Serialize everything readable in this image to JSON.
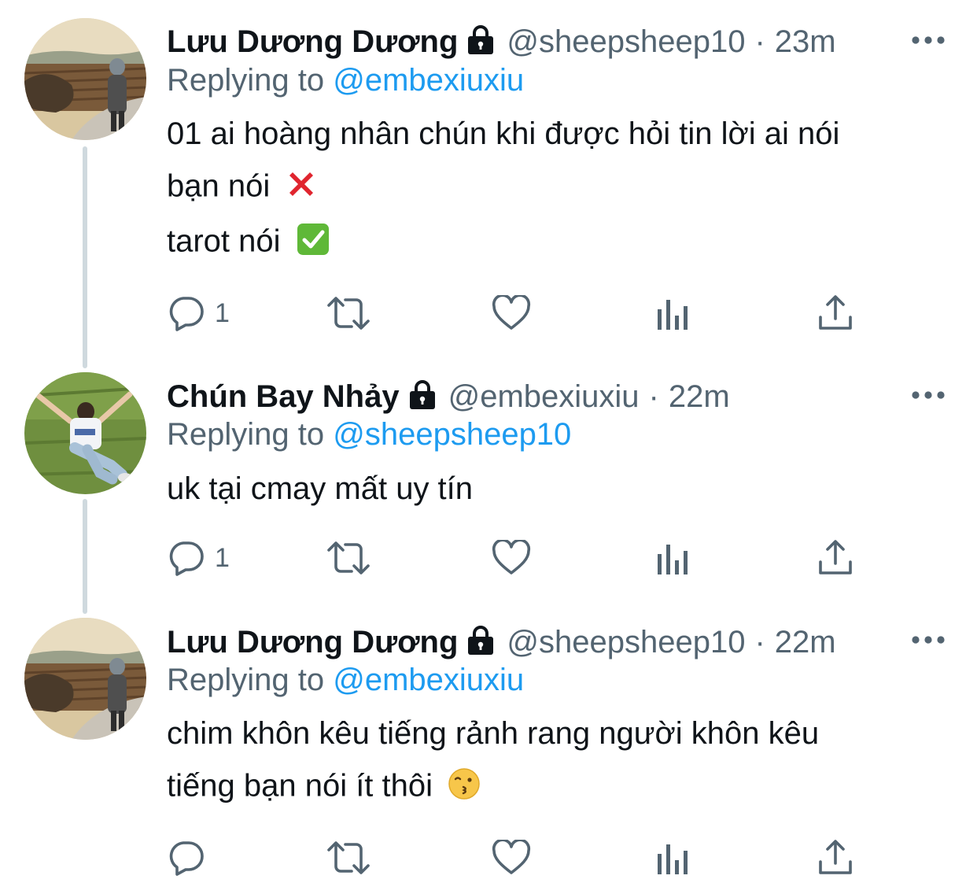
{
  "thread": {
    "tweets": [
      {
        "display_name": "Lưu Dương Dương",
        "handle": "@sheepsheep10",
        "dot": "·",
        "time": "23m",
        "replying_prefix": "Replying to ",
        "replying_to": "@embexiuxiu",
        "body_lines": [
          "01 ai hoàng nhân chún khi được hỏi tin lời ai nói",
          "bạn nói",
          "tarot nói"
        ],
        "reply_count": "1",
        "avatar_icon": "avatar-landscape-person"
      },
      {
        "display_name": "Chún Bay Nhảy",
        "handle": "@embexiuxiu",
        "dot": "·",
        "time": "22m",
        "replying_prefix": "Replying to ",
        "replying_to": "@sheepsheep10",
        "body_lines": [
          "uk tại cmay mất uy tín"
        ],
        "reply_count": "1",
        "avatar_icon": "avatar-grass-person"
      },
      {
        "display_name": "Lưu Dương Dương",
        "handle": "@sheepsheep10",
        "dot": "·",
        "time": "22m",
        "replying_prefix": "Replying to ",
        "replying_to": "@embexiuxiu",
        "body_lines": [
          "chim khôn kêu tiếng rảnh rang người khôn kêu",
          "tiếng bạn nói ít thôi"
        ],
        "reply_count": "",
        "avatar_icon": "avatar-landscape-person"
      }
    ]
  },
  "icons": {
    "lock": "lock-icon",
    "more": "more-icon",
    "reply": "reply-icon",
    "retweet": "retweet-icon",
    "like": "heart-icon",
    "analytics": "analytics-icon",
    "share": "share-icon",
    "cross_mark": "cross-mark-emoji",
    "check_mark": "check-mark-emoji",
    "kissing_face": "kissing-face-emoji"
  },
  "colors": {
    "text": "#0f1419",
    "secondary": "#536471",
    "link": "#1d9bf0",
    "thread_line": "#cfd9de"
  }
}
